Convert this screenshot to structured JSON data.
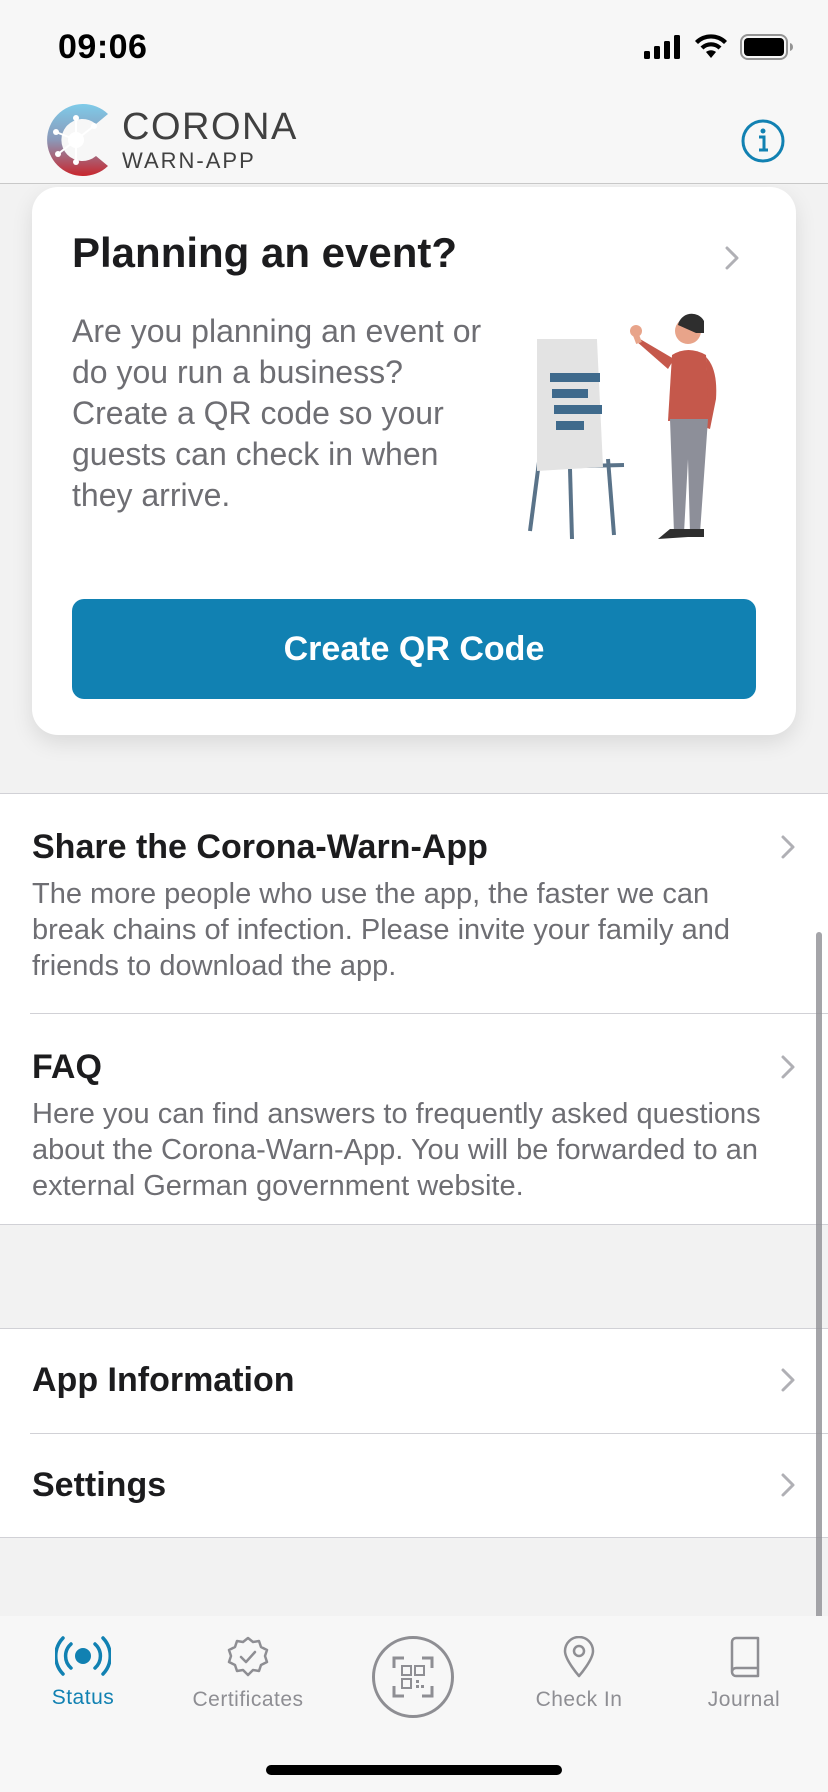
{
  "status_bar": {
    "time": "09:06"
  },
  "header": {
    "logo_title": "CORONA",
    "logo_subtitle": "WARN-APP"
  },
  "event_card": {
    "title": "Planning an event?",
    "description": "Are you planning an event or do you run a business? Create a QR code so your guests can check in when they arrive.",
    "button_label": "Create QR Code"
  },
  "menu_section_1": [
    {
      "title": "Share the Corona-Warn-App",
      "description": "The more people who use the app, the faster we can break chains of infection. Please invite your family and friends to download the app."
    },
    {
      "title": "FAQ",
      "description": "Here you can find answers to frequently asked questions about the Corona-Warn-App. You will be forwarded to an external German government website."
    }
  ],
  "menu_section_2": [
    {
      "title": "App Information"
    },
    {
      "title": "Settings"
    }
  ],
  "tab_bar": {
    "tabs": [
      {
        "label": "Status",
        "icon": "status-broadcast-icon",
        "active": true
      },
      {
        "label": "Certificates",
        "icon": "certificate-badge-icon",
        "active": false
      },
      {
        "label": "",
        "icon": "qr-scan-icon",
        "active": false
      },
      {
        "label": "Check In",
        "icon": "location-pin-icon",
        "active": false
      },
      {
        "label": "Journal",
        "icon": "book-icon",
        "active": false
      }
    ]
  },
  "colors": {
    "accent": "#1181b2",
    "secondary_text": "#6e6e73",
    "inactive_tab": "#8e8e93"
  }
}
